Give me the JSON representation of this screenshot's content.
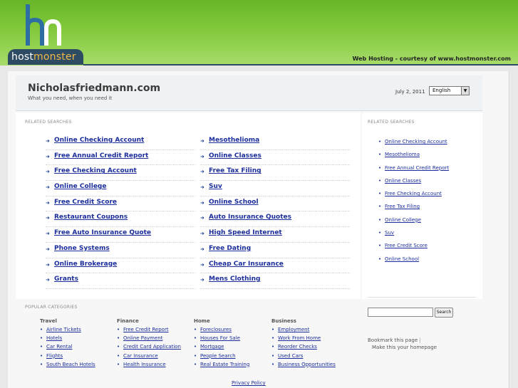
{
  "header": {
    "logo_host": "host",
    "logo_monster": "monster",
    "courtesy": "Web Hosting - courtesy of www.hostmonster.com"
  },
  "site": {
    "title": "Nicholasfriedmann.com",
    "tagline": "What you need, when you need it",
    "date": "July 2, 2011",
    "language": "English"
  },
  "related": {
    "label": "RELATED SEARCHES",
    "left_col": [
      "Online Checking Account",
      "Free Annual Credit Report",
      "Free Checking Account",
      "Online College",
      "Free Credit Score",
      "Restaurant Coupons",
      "Free Auto Insurance Quote",
      "Phone Systems",
      "Online Brokerage",
      "Grants"
    ],
    "right_col": [
      "Mesothelioma",
      "Online Classes",
      "Free Tax Filing",
      "Suv",
      "Online School",
      "Auto Insurance Quotes",
      "High Speed Internet",
      "Free Dating",
      "Cheap Car Insurance",
      "Mens Clothing"
    ]
  },
  "sidebar": {
    "label": "RELATED SEARCHES",
    "items": [
      "Online Checking Account",
      "Mesothelioma",
      "Free Annual Credit Report",
      "Online Classes",
      "Free Checking Account",
      "Free Tax Filing",
      "Online College",
      "Suv",
      "Free Credit Score",
      "Online School"
    ],
    "search_button": "Search",
    "bookmark": "Bookmark this page",
    "homepage": "Make this your homepage"
  },
  "popular": {
    "label": "POPULAR CATEGORIES",
    "categories": [
      {
        "title": "Travel",
        "items": [
          "Airline Tickets",
          "Hotels",
          "Car Rental",
          "Flights",
          "South Beach Hotels"
        ]
      },
      {
        "title": "Finance",
        "items": [
          "Free Credit Report",
          "Online Payment",
          "Credit Card Application",
          "Car Insurance",
          "Health Insurance"
        ]
      },
      {
        "title": "Home",
        "items": [
          "Foreclosures",
          "Houses For Sale",
          "Mortgage",
          "People Search",
          "Real Estate Training"
        ]
      },
      {
        "title": "Business",
        "items": [
          "Employment",
          "Work From Home",
          "Reorder Checks",
          "Used Cars",
          "Business Opportunities"
        ]
      }
    ]
  },
  "footer": {
    "privacy": "Privacy Policy"
  },
  "colors": {
    "header_green": "#82c93b",
    "link_blue": "#1b2e9c",
    "logo_navy": "#2d4c63",
    "logo_orange": "#f2b74a"
  }
}
